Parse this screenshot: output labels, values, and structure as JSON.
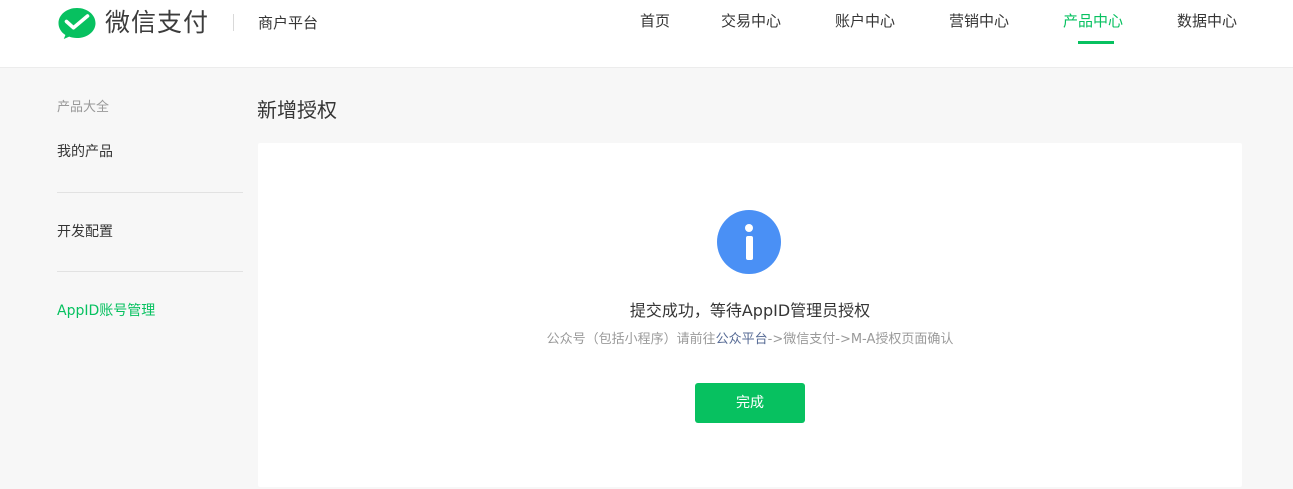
{
  "header": {
    "brand_name": "微信支付",
    "platform_name": "商户平台",
    "nav": [
      {
        "label": "首页",
        "active": false
      },
      {
        "label": "交易中心",
        "active": false
      },
      {
        "label": "账户中心",
        "active": false
      },
      {
        "label": "营销中心",
        "active": false
      },
      {
        "label": "产品中心",
        "active": true
      },
      {
        "label": "数据中心",
        "active": false
      }
    ]
  },
  "sidebar": {
    "group_label": "产品大全",
    "items": [
      {
        "label": "我的产品",
        "active": false
      },
      {
        "label": "开发配置",
        "active": false
      },
      {
        "label": "AppID账号管理",
        "active": true
      }
    ]
  },
  "main": {
    "title": "新增授权",
    "icon": "info-icon",
    "message_title": "提交成功，等待AppID管理员授权",
    "message_desc_prefix": "公众号（包括小程序）请前往",
    "message_desc_link": "公众平台",
    "message_desc_suffix": "->微信支付->M-A授权页面确认",
    "done_label": "完成"
  },
  "colors": {
    "accent": "#07c160",
    "info_icon": "#4a90f5",
    "link": "#576b95",
    "text": "#353535",
    "muted": "#9a9a9a"
  }
}
